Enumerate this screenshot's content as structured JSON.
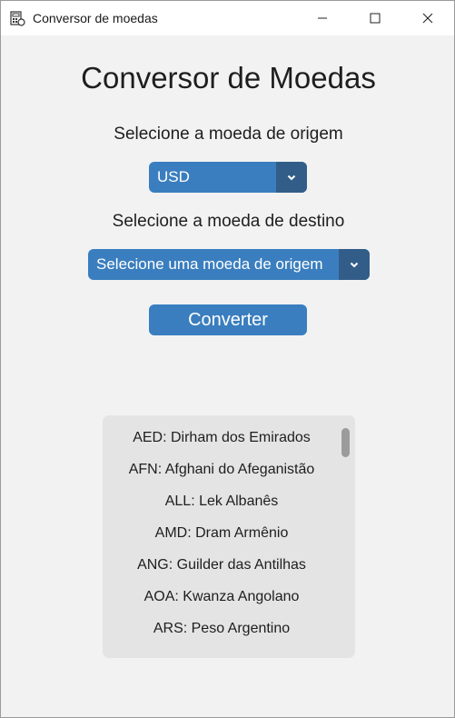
{
  "window": {
    "title": "Conversor de moedas"
  },
  "main": {
    "heading": "Conversor de Moedas",
    "origin_label": "Selecione a moeda de origem",
    "origin_value": "USD",
    "dest_label": "Selecione a moeda de destino",
    "dest_value": "Selecione uma moeda de origem",
    "convert_label": "Converter"
  },
  "currency_list": [
    "AED: Dirham dos Emirados",
    "AFN: Afghani do Afeganistão",
    "ALL: Lek Albanês",
    "AMD: Dram Armênio",
    "ANG: Guilder das Antilhas",
    "AOA: Kwanza Angolano",
    "ARS: Peso Argentino"
  ],
  "colors": {
    "accent": "#3a7ebf",
    "accent_dark": "#325d88",
    "background": "#f2f2f3",
    "list_bg": "#e4e4e5"
  },
  "icons": [
    "calculator-app-icon",
    "minimize-icon",
    "maximize-icon",
    "close-icon",
    "chevron-down-icon"
  ]
}
